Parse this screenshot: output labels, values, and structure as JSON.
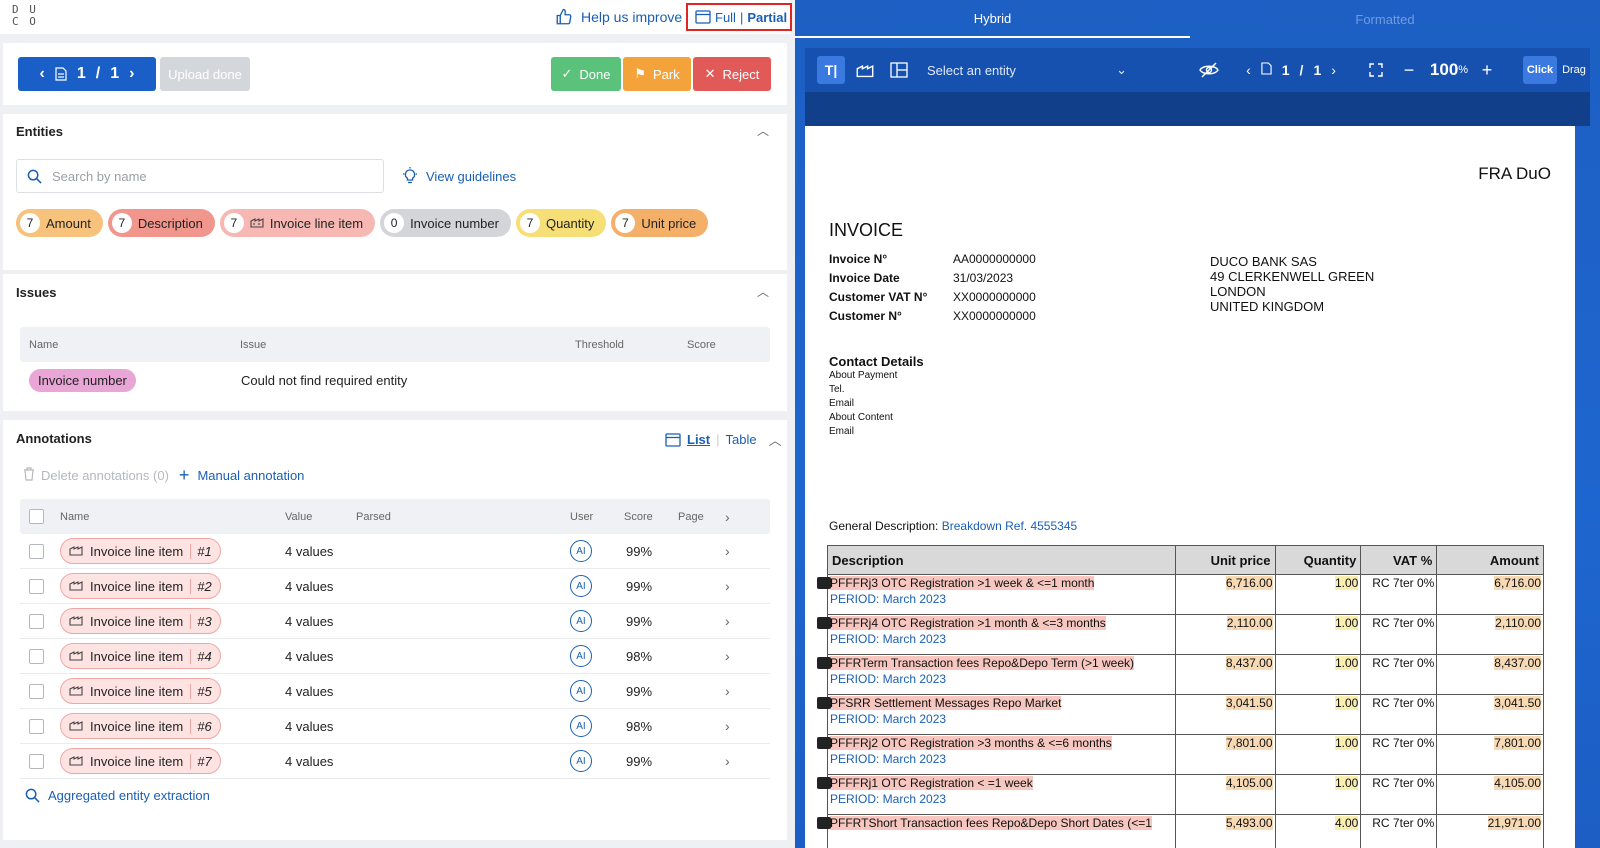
{
  "topbar": {
    "logo_text": "DU CO",
    "help_label": "Help us improve",
    "view_full": "Full",
    "view_sep": "|",
    "view_partial": "Partial"
  },
  "toolbar": {
    "page_current": "1",
    "page_sep": "/",
    "page_total": "1",
    "upload_done": "Upload done",
    "done": "Done",
    "park": "Park",
    "reject": "Reject",
    "colors": {
      "primary": "#1a5fc8",
      "done": "#5ac27a",
      "park": "#f4a23a",
      "reject": "#e15a58"
    }
  },
  "entities": {
    "title": "Entities",
    "search_placeholder": "Search by name",
    "guidelines": "View guidelines",
    "chips": [
      {
        "count": "7",
        "label": "Amount",
        "color": "#f6c27c"
      },
      {
        "count": "7",
        "label": "Description",
        "color": "#f0968c"
      },
      {
        "count": "7",
        "label": "Invoice line item",
        "color": "#f7b8b4",
        "icon": "factory-icon"
      },
      {
        "count": "0",
        "label": "Invoice number",
        "color": "#d3d5d9"
      },
      {
        "count": "7",
        "label": "Quantity",
        "color": "#f7df78"
      },
      {
        "count": "7",
        "label": "Unit price",
        "color": "#f4b068"
      }
    ]
  },
  "issues": {
    "title": "Issues",
    "columns": [
      "Name",
      "Issue",
      "Threshold",
      "Score"
    ],
    "rows": [
      {
        "name": "Invoice number",
        "issue": "Could not find required entity",
        "threshold": "",
        "score": ""
      }
    ]
  },
  "annotations": {
    "title": "Annotations",
    "list_label": "List",
    "table_label": "Table",
    "delete_label": "Delete annotations (0)",
    "manual_label": "Manual annotation",
    "columns": [
      "Name",
      "Value",
      "Parsed",
      "User",
      "Score",
      "Page"
    ],
    "rows": [
      {
        "name": "Invoice line item",
        "num": "#1",
        "value": "4 values",
        "user": "AI",
        "score": "99%"
      },
      {
        "name": "Invoice line item",
        "num": "#2",
        "value": "4 values",
        "user": "AI",
        "score": "99%"
      },
      {
        "name": "Invoice line item",
        "num": "#3",
        "value": "4 values",
        "user": "AI",
        "score": "99%"
      },
      {
        "name": "Invoice line item",
        "num": "#4",
        "value": "4 values",
        "user": "AI",
        "score": "98%"
      },
      {
        "name": "Invoice line item",
        "num": "#5",
        "value": "4 values",
        "user": "AI",
        "score": "99%"
      },
      {
        "name": "Invoice line item",
        "num": "#6",
        "value": "4 values",
        "user": "AI",
        "score": "98%"
      },
      {
        "name": "Invoice line item",
        "num": "#7",
        "value": "4 values",
        "user": "AI",
        "score": "99%"
      }
    ],
    "aggregated": "Aggregated entity extraction"
  },
  "viewer": {
    "tab_hybrid": "Hybrid",
    "tab_formatted": "Formatted",
    "entity_select": "Select an entity",
    "page_current": "1",
    "page_sep": "/",
    "page_total": "1",
    "zoom": "100",
    "zoom_unit": "%",
    "click": "Click",
    "drag": "Drag"
  },
  "document": {
    "company": "FRA DuO",
    "title": "INVOICE",
    "fields": [
      {
        "k": "Invoice N°",
        "v": "AA0000000000"
      },
      {
        "k": "Invoice Date",
        "v": "31/03/2023"
      },
      {
        "k": "Customer VAT N°",
        "v": "XX0000000000"
      },
      {
        "k": "Customer N°",
        "v": "XX0000000000"
      }
    ],
    "address": [
      "DUCO BANK SAS",
      "49 CLERKENWELL GREEN",
      "LONDON",
      "UNITED KINGDOM"
    ],
    "contact_title": "Contact Details",
    "contact_lines": [
      "About Payment",
      "Tel.",
      "Email",
      "About Content",
      "Email"
    ],
    "general_label": "General Description:",
    "general_value": "Breakdown Ref. 4555345",
    "table_headers": [
      "Description",
      "Unit price",
      "Quantity",
      "VAT %",
      "Amount"
    ],
    "lines": [
      {
        "desc": "PFFFRj3 OTC Registration >1 week & <=1 month",
        "period": "PERIOD: March 2023",
        "unit": "6,716.00",
        "qty": "1.00",
        "vat": "RC 7ter 0%",
        "amount": "6,716.00"
      },
      {
        "desc": "PFFFRj4 OTC Registration >1 month & <=3 months",
        "period": "PERIOD: March 2023",
        "unit": "2,110.00",
        "qty": "1.00",
        "vat": "RC 7ter 0%",
        "amount": "2,110.00"
      },
      {
        "desc": "PFFRTerm Transaction fees Repo&Depo Term (>1 week)",
        "period": "PERIOD: March 2023",
        "unit": "8,437.00",
        "qty": "1.00",
        "vat": "RC 7ter 0%",
        "amount": "8,437.00"
      },
      {
        "desc": "PFSRR Settlement Messages Repo Market",
        "period": "PERIOD: March 2023",
        "unit": "3,041.50",
        "qty": "1.00",
        "vat": "RC 7ter 0%",
        "amount": "3,041.50"
      },
      {
        "desc": "PFFFRj2 OTC Registration >3 months & <=6 months",
        "period": "PERIOD: March 2023",
        "unit": "7,801.00",
        "qty": "1.00",
        "vat": "RC 7ter 0%",
        "amount": "7,801.00"
      },
      {
        "desc": "PFFFRj1 OTC Registration < =1 week",
        "period": "PERIOD: March 2023",
        "unit": "4,105.00",
        "qty": "1.00",
        "vat": "RC 7ter 0%",
        "amount": "4,105.00"
      },
      {
        "desc": "PFFRTShort Transaction fees Repo&Depo Short Dates (<=1",
        "period": "",
        "unit": "5,493.00",
        "qty": "4.00",
        "vat": "RC 7ter 0%",
        "amount": "21,971.00"
      }
    ]
  }
}
